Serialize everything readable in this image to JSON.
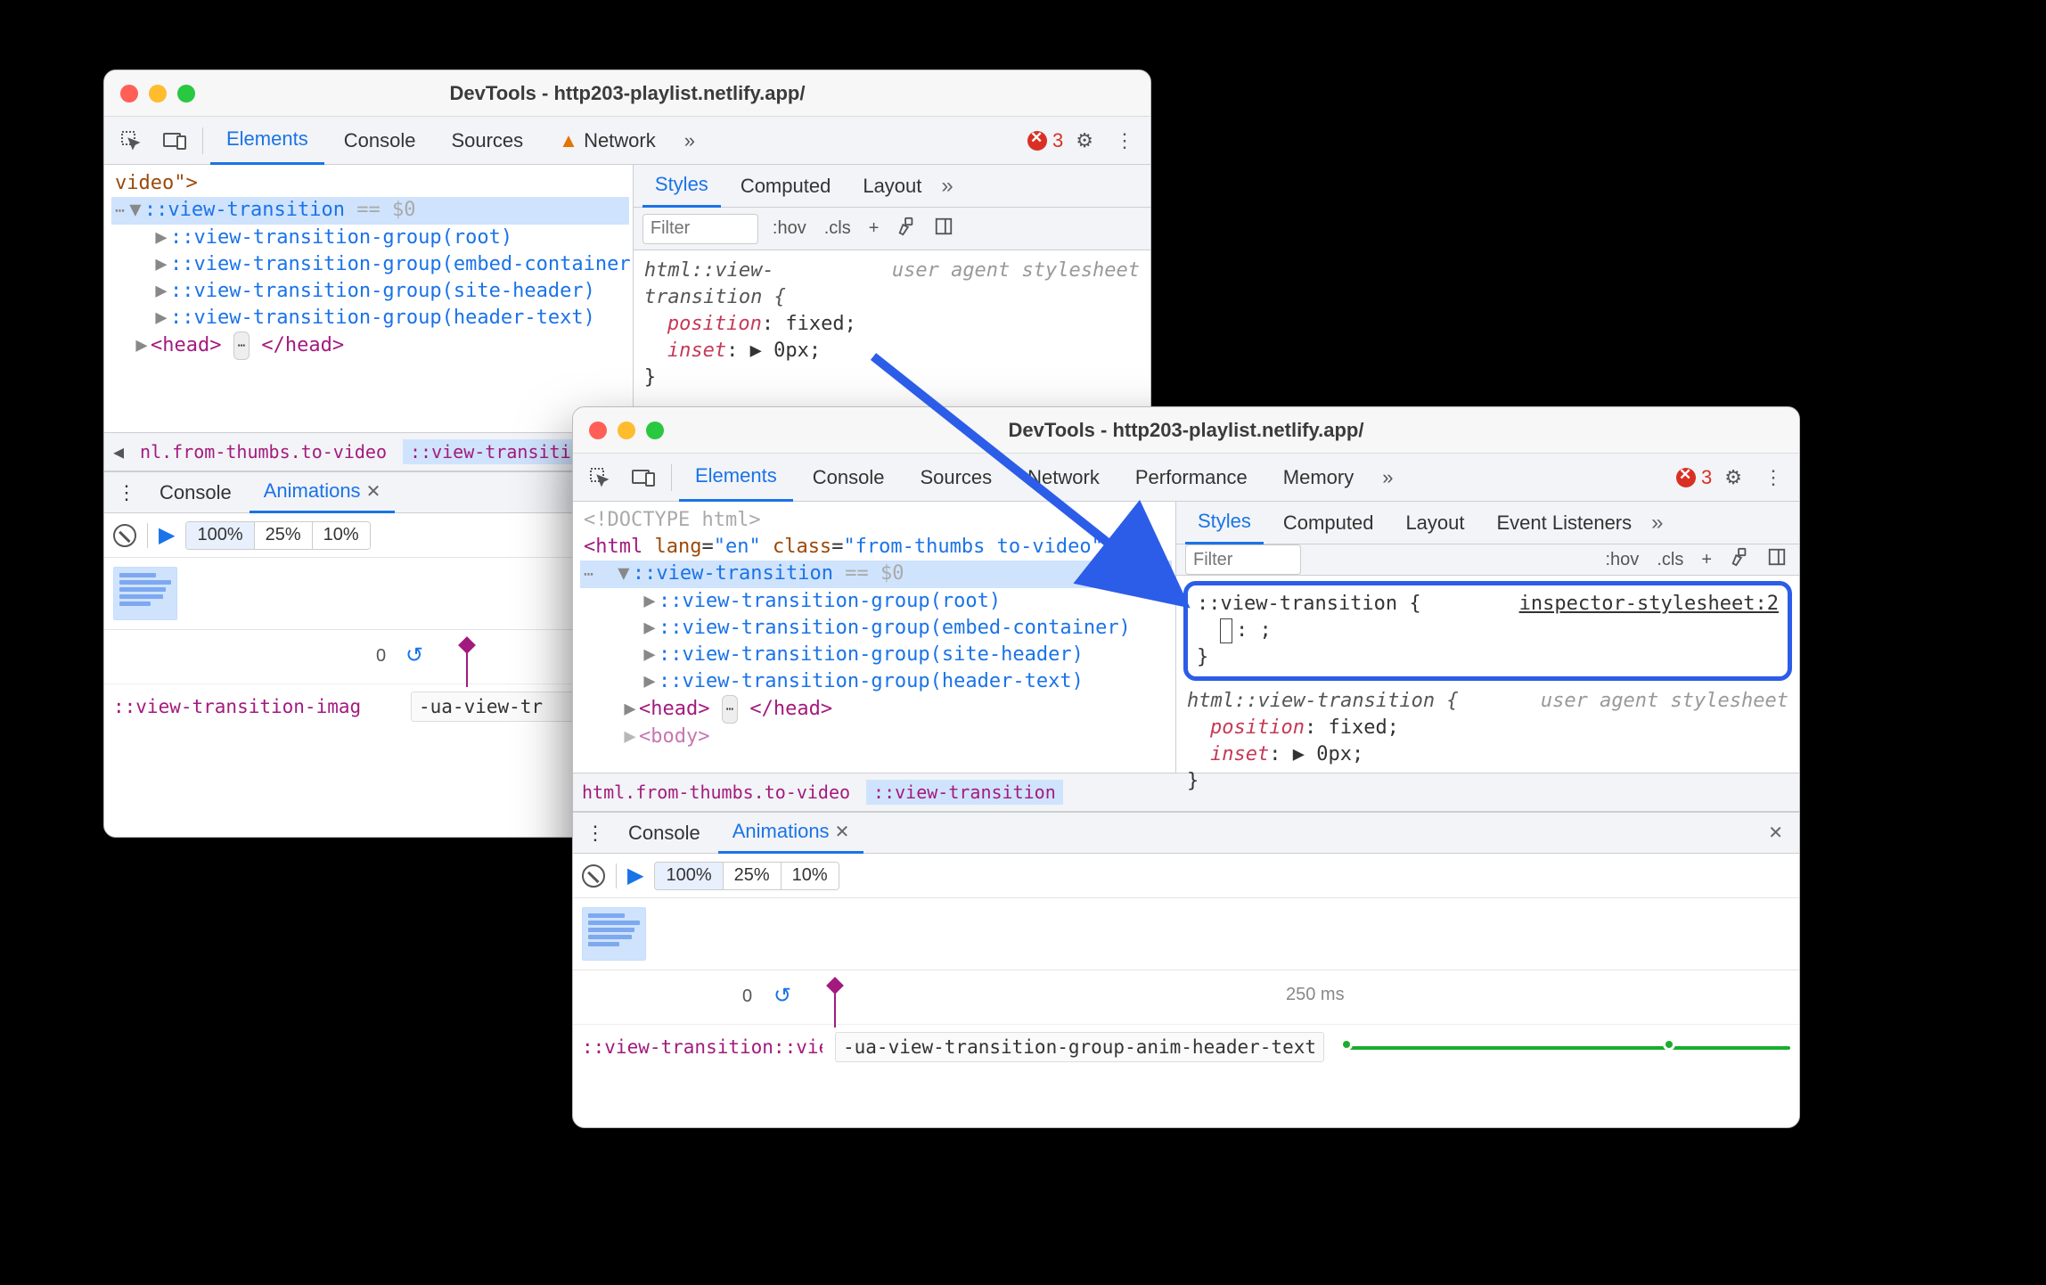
{
  "windowA": {
    "title": "DevTools - http203-playlist.netlify.app/",
    "tabs": [
      "Elements",
      "Console",
      "Sources",
      "Network"
    ],
    "activeTab": "Elements",
    "networkHasWarning": true,
    "errorCount": "3",
    "dom": {
      "line0": "video\">",
      "sel": "::view-transition",
      "selEq": "== $0",
      "groups": [
        "::view-transition-group(root)",
        "::view-transition-group(embed-container)",
        "::view-transition-group(site-header)",
        "::view-transition-group(header-text)"
      ],
      "head": "<head> ⋯ </head>"
    },
    "breadcrumb": {
      "left": "nl.from-thumbs.to-video",
      "sel": "::view-transition"
    },
    "styles": {
      "subtabs": [
        "Styles",
        "Computed",
        "Layout"
      ],
      "activeSubtab": "Styles",
      "filterPlaceholder": "Filter",
      "tools": [
        ":hov",
        ".cls",
        "+"
      ],
      "rule": {
        "selector": "html::view-transition {",
        "source": "user agent stylesheet",
        "p1n": "position",
        "p1v": ": fixed;",
        "p2n": "inset",
        "p2v": ": ▶ 0px;",
        "close": "}"
      }
    },
    "drawer": {
      "tabs": [
        "Console",
        "Animations"
      ],
      "activeTab": "Animations",
      "speeds": [
        "100%",
        "25%",
        "10%"
      ],
      "activeSpeed": "100%",
      "zero": "0",
      "animRow": {
        "name": "::view-transition-imag",
        "label": "-ua-view-tr"
      }
    }
  },
  "windowB": {
    "title": "DevTools - http203-playlist.netlify.app/",
    "tabs": [
      "Elements",
      "Console",
      "Sources",
      "Network",
      "Performance",
      "Memory"
    ],
    "activeTab": "Elements",
    "errorCount": "3",
    "dom": {
      "doctype": "<!DOCTYPE html>",
      "htmlOpenPrefix": "<",
      "htmlTag": "html",
      "attr1n": "lang",
      "attr1v": "\"en\"",
      "attr2n": "class",
      "attr2v": "\"from-thumbs to-video\"",
      "htmlOpenSuffix": ">",
      "sel": "::view-transition",
      "selEq": "== $0",
      "groups": [
        "::view-transition-group(root)",
        "::view-transition-group(embed-container)",
        "::view-transition-group(site-header)",
        "::view-transition-group(header-text)"
      ],
      "head": "<head> ⋯ </head>",
      "body": "<body>"
    },
    "breadcrumb": {
      "left": "html.from-thumbs.to-video",
      "sel": "::view-transition"
    },
    "styles": {
      "subtabs": [
        "Styles",
        "Computed",
        "Layout",
        "Event Listeners"
      ],
      "activeSubtab": "Styles",
      "filterPlaceholder": "Filter",
      "tools": [
        ":hov",
        ".cls",
        "+"
      ],
      "editing": {
        "selector": "::view-transition {",
        "source": "inspector-stylesheet:2",
        "line2": ": ;",
        "close": "}"
      },
      "rule": {
        "selector": "html::view-transition {",
        "source": "user agent stylesheet",
        "p1n": "position",
        "p1v": ": fixed;",
        "p2n": "inset",
        "p2v": ": ▶ 0px;",
        "close": "}"
      }
    },
    "drawer": {
      "tabs": [
        "Console",
        "Animations"
      ],
      "activeTab": "Animations",
      "speeds": [
        "100%",
        "25%",
        "10%"
      ],
      "activeSpeed": "100%",
      "zero": "0",
      "ms": "250 ms",
      "animRow": {
        "name": "::view-transition::vie",
        "label": "-ua-view-transition-group-anim-header-text"
      }
    }
  }
}
